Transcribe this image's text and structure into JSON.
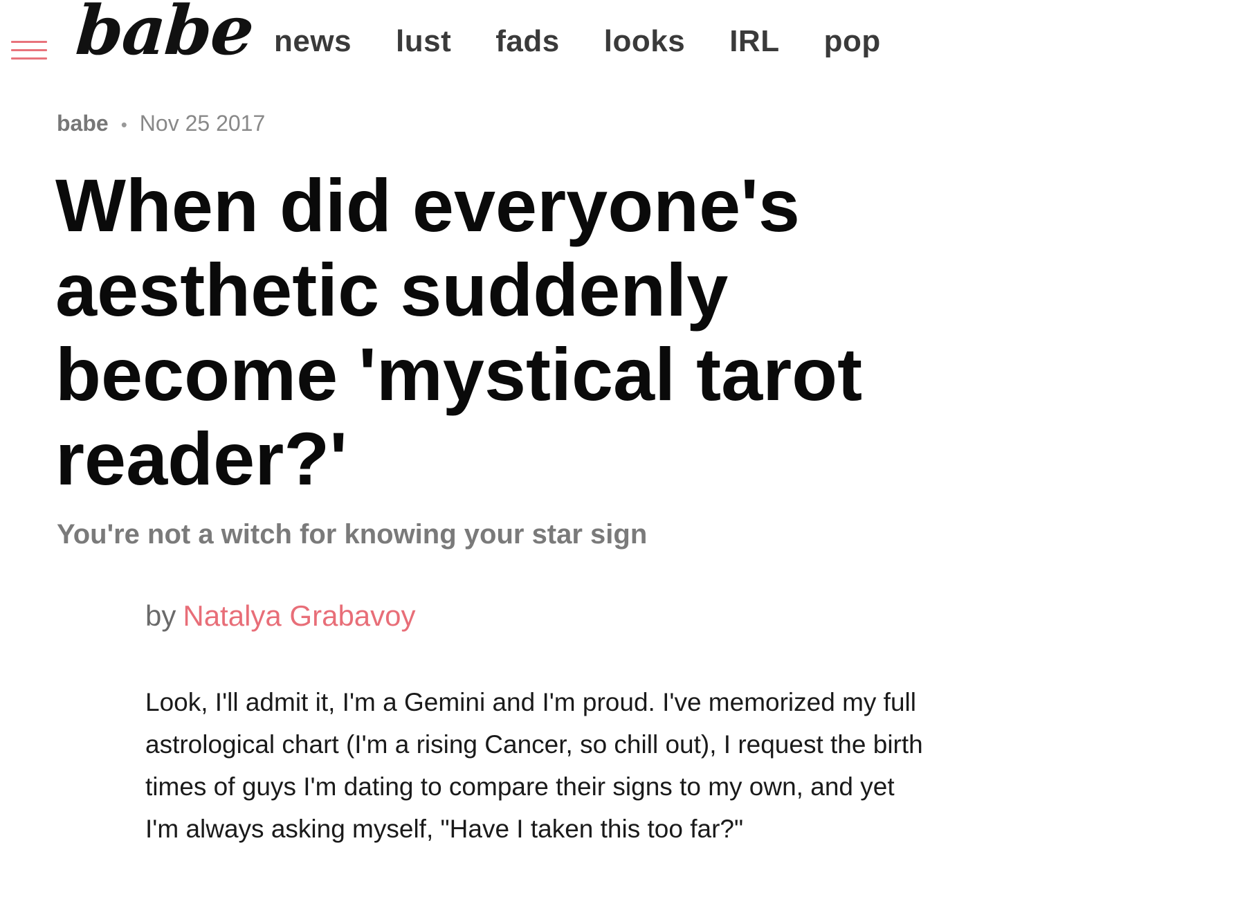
{
  "header": {
    "logo": "babe",
    "nav": [
      "news",
      "lust",
      "fads",
      "looks",
      "IRL",
      "pop"
    ]
  },
  "article": {
    "source": "babe",
    "date": "Nov 25 2017",
    "title": "When did everyone's aesthetic suddenly become 'mystical tarot reader?'",
    "subtitle": "You're not a witch for knowing your star sign",
    "byline_prefix": "by",
    "author": "Natalya Grabavoy",
    "body": "Look, I'll admit it, I'm a Gemini and I'm proud. I've memorized my full astrological chart (I'm a rising Cancer, so chill out), I request the birth times of guys I'm dating to compare their signs to my own, and yet I'm always asking myself, \"Have I taken this too far?\""
  },
  "colors": {
    "accent": "#e8737b",
    "text": "#0a0a0a",
    "muted": "#7a7a7a"
  },
  "icons": {
    "menu": "hamburger-menu-icon"
  }
}
